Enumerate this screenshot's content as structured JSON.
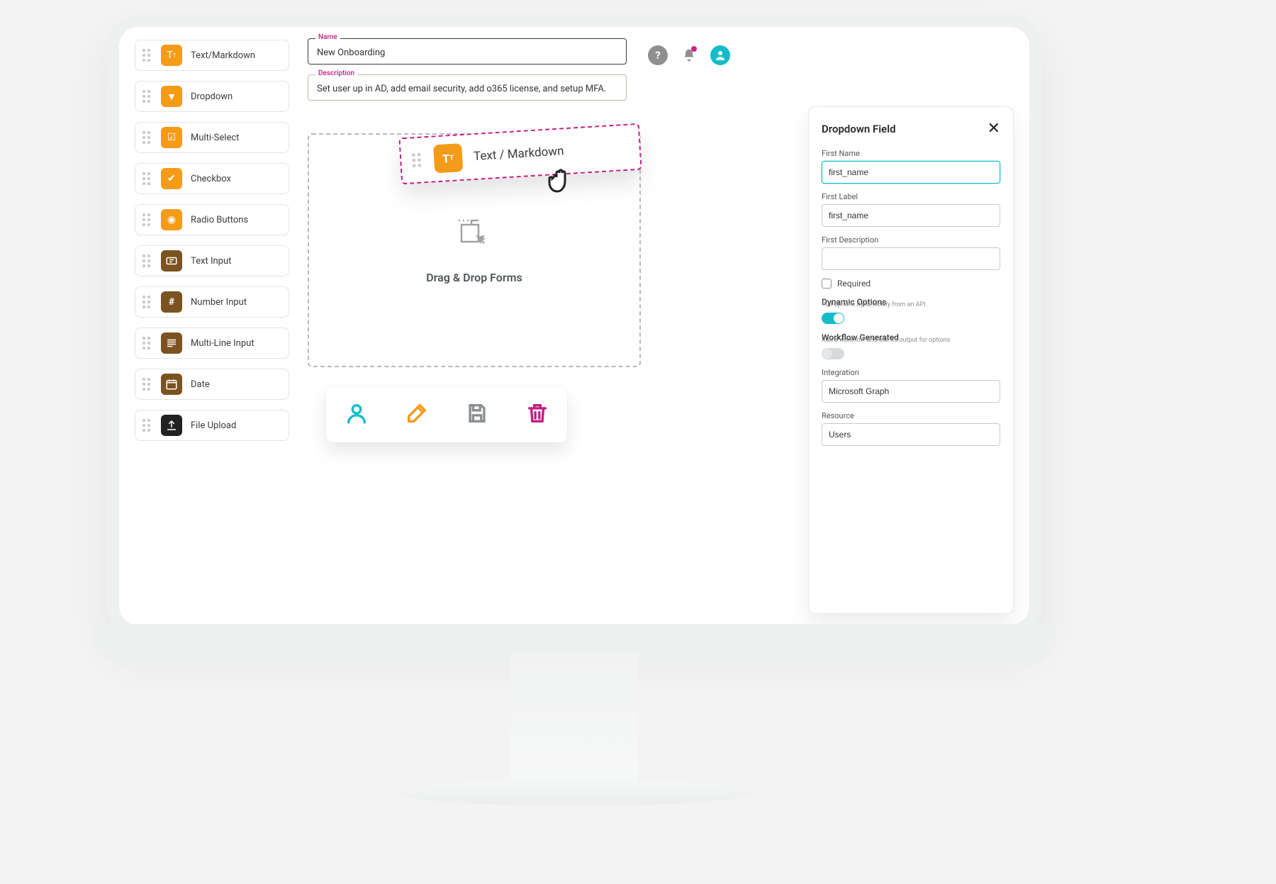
{
  "palette": {
    "items": [
      {
        "label": "Text/Markdown",
        "icon": "text",
        "color": "orange"
      },
      {
        "label": "Dropdown",
        "icon": "dropdown",
        "color": "orange"
      },
      {
        "label": "Multi-Select",
        "icon": "multiselect",
        "color": "orange"
      },
      {
        "label": "Checkbox",
        "icon": "checkbox",
        "color": "orange"
      },
      {
        "label": "Radio Buttons",
        "icon": "radio",
        "color": "orange"
      },
      {
        "label": "Text Input",
        "icon": "textinput",
        "color": "brown"
      },
      {
        "label": "Number Input",
        "icon": "number",
        "color": "brown"
      },
      {
        "label": "Multi-Line Input",
        "icon": "multiline",
        "color": "brown"
      },
      {
        "label": "Date",
        "icon": "date",
        "color": "brown"
      },
      {
        "label": "File Upload",
        "icon": "upload",
        "color": "black"
      }
    ]
  },
  "header": {
    "name_label": "Name",
    "name_value": "New Onboarding",
    "desc_label": "Description",
    "desc_value": "Set user up in AD, add email security, add o365 license, and setup MFA."
  },
  "dropzone": {
    "text": "Drag & Drop Forms"
  },
  "drag_ghost": {
    "label": "Text / Markdown"
  },
  "panel": {
    "title": "Dropdown Field",
    "first_name_label": "First Name",
    "first_name_value": "first_name",
    "first_label_label": "First Label",
    "first_label_value": "first_name",
    "first_desc_label": "First Description",
    "first_desc_value": "",
    "required_label": "Required",
    "dyn_title": "Dynamic Options",
    "dyn_sub": "Pull options dynamically from an API",
    "wf_title": "Workflow Generated",
    "wf_sub": "Run a workflow and use its output for options",
    "integration_label": "Integration",
    "integration_value": "Microsoft Graph",
    "resource_label": "Resource",
    "resource_value": "Users"
  }
}
